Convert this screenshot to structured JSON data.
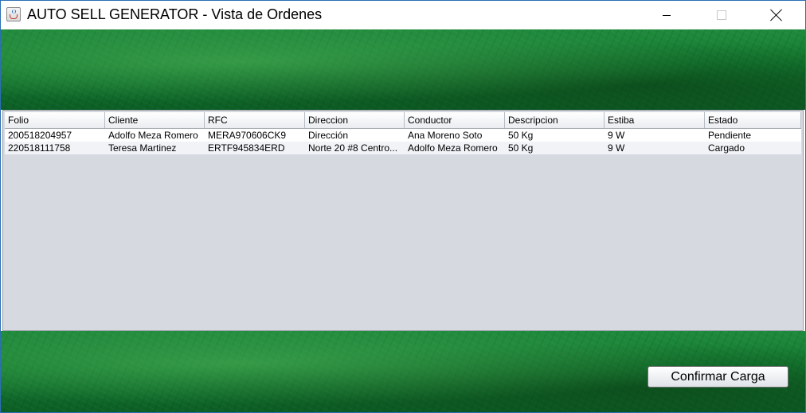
{
  "window": {
    "title": "AUTO SELL GENERATOR - Vista de Ordenes",
    "icon": "java-cup-icon",
    "controls": [
      "minimize-icon",
      "maximize-icon",
      "close-icon"
    ]
  },
  "table": {
    "columns": [
      "Folio",
      "Cliente",
      "RFC",
      "Direccion",
      "Conductor",
      "Descripcion",
      "Estiba",
      "Estado"
    ],
    "rows": [
      [
        "200518204957",
        "Adolfo Meza Romero",
        "MERA970606CK9",
        "Dirección",
        "Ana Moreno Soto",
        "50 Kg",
        "9 W",
        "Pendiente"
      ],
      [
        "220518111758",
        "Teresa Martinez",
        "ERTF945834ERD",
        "Norte 20 #8 Centro...",
        "Adolfo Meza Romero",
        "50 Kg",
        "9 W",
        "Cargado"
      ]
    ]
  },
  "actions": {
    "confirm_label": "Confirmar Carga"
  },
  "colors": {
    "background": "#137a30",
    "table_background": "#d6d9e0",
    "row": "#ffffff"
  }
}
